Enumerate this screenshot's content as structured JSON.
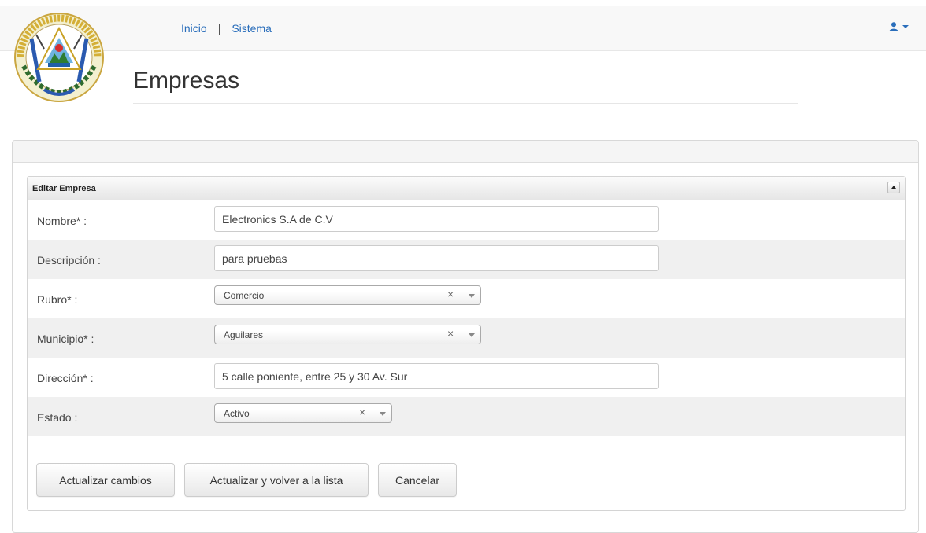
{
  "nav": {
    "links": [
      "Inicio",
      "Sistema"
    ],
    "separator": "|",
    "user_icon": "user-icon",
    "seal_icon": "coat-of-arms-el-salvador"
  },
  "page": {
    "title": "Empresas"
  },
  "form": {
    "header": "Editar Empresa",
    "fields": {
      "nombre": {
        "label": "Nombre* :",
        "value": "Electronics S.A de C.V"
      },
      "descripcion": {
        "label": "Descripción :",
        "value": "para pruebas"
      },
      "rubro": {
        "label": "Rubro* :",
        "value": "Comercio"
      },
      "municipio": {
        "label": "Municipio* :",
        "value": "Aguilares"
      },
      "direccion": {
        "label": "Dirección* :",
        "value": "5 calle poniente, entre 25 y 30 Av. Sur"
      },
      "estado": {
        "label": "Estado :",
        "value": "Activo"
      }
    },
    "select_clear": "×"
  },
  "buttons": {
    "update": "Actualizar cambios",
    "update_return": "Actualizar y volver a la lista",
    "cancel": "Cancelar"
  },
  "colors": {
    "link": "#2a6ebb",
    "navbar_bg": "#f8f8f8",
    "alt_row": "#f0f0f0"
  }
}
